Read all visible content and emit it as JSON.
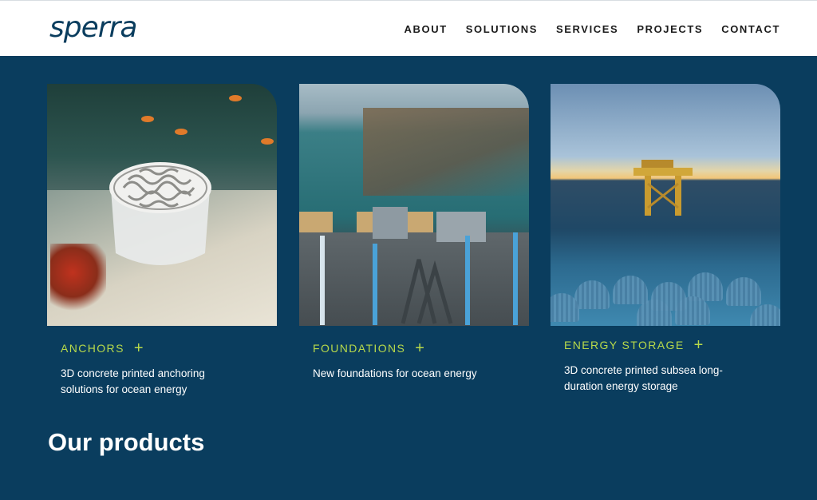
{
  "brand": {
    "logo_text": "sperra",
    "primary_color": "#0a3d5e",
    "accent_color": "#b7d94a"
  },
  "nav": {
    "items": [
      "ABOUT",
      "SOLUTIONS",
      "SERVICES",
      "PROJECTS",
      "CONTACT"
    ]
  },
  "cards": [
    {
      "title": "ANCHORS",
      "plus": "+",
      "description": "3D concrete printed anchoring solutions for ocean energy"
    },
    {
      "title": "FOUNDATIONS",
      "plus": "+",
      "description": "New foundations for ocean energy"
    },
    {
      "title": "ENERGY STORAGE",
      "plus": "+",
      "description": "3D concrete printed subsea long-duration energy storage"
    }
  ],
  "products": {
    "heading": "Our products"
  }
}
